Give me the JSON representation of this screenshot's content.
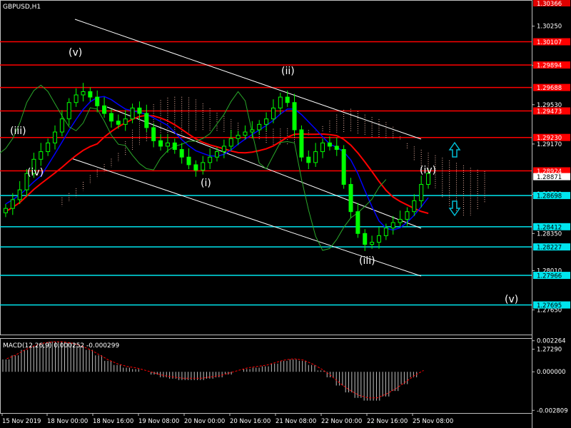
{
  "chart_data": [
    {
      "type": "candlestick",
      "title": "GBPUSD,H1",
      "yaxis_ticks": [
        "1.30250",
        "1.29890",
        "1.29530",
        "1.29170",
        "1.28710",
        "1.28350",
        "1.28010",
        "1.27650",
        "1.27290"
      ],
      "x_ticks": [
        "15 Nov 2019",
        "18 Nov 00:00",
        "18 Nov 16:00",
        "19 Nov 08:00",
        "20 Nov 00:00",
        "20 Nov 16:00",
        "21 Nov 08:00",
        "22 Nov 00:00",
        "22 Nov 16:00",
        "25 Nov 08:00"
      ],
      "ylim": [
        1.2745,
        1.3047
      ],
      "price_tag": {
        "value": "1.30366",
        "color": "#e00000"
      },
      "levels": [
        {
          "value": 1.30107,
          "label": "1.30107",
          "color": "#ff0000"
        },
        {
          "value": 1.29894,
          "label": "1.29894",
          "color": "#ff0000"
        },
        {
          "value": 1.29688,
          "label": "1.29688",
          "color": "#ff0000"
        },
        {
          "value": 1.29473,
          "label": "1.29473",
          "color": "#ff0000"
        },
        {
          "value": 1.2923,
          "label": "1.29230",
          "color": "#ff0000"
        },
        {
          "value": 1.28924,
          "label": "1.28924",
          "color": "#ff0000"
        },
        {
          "value": 1.28698,
          "label": "1.28698",
          "color": "#00e5ee"
        },
        {
          "value": 1.28412,
          "label": "1.28412",
          "color": "#00e5ee"
        },
        {
          "value": 1.28227,
          "label": "1.28227",
          "color": "#00e5ee"
        },
        {
          "value": 1.27966,
          "label": "1.27966",
          "color": "#00e5ee"
        },
        {
          "value": 1.27695,
          "label": "1.27695",
          "color": "#00e5ee"
        }
      ],
      "current_price": {
        "value": 1.28871,
        "label": "1.28871"
      },
      "wave_labels": [
        "(iii)",
        "(iv)",
        "(v)",
        "(i)",
        "(ii)",
        "(iii)",
        "(iv)",
        "(v)"
      ],
      "close_series": [
        1.2858,
        1.2866,
        1.2875,
        1.289,
        1.2903,
        1.291,
        1.2918,
        1.2928,
        1.294,
        1.2955,
        1.2962,
        1.2965,
        1.296,
        1.2952,
        1.2945,
        1.2938,
        1.2935,
        1.294,
        1.295,
        1.2945,
        1.2932,
        1.292,
        1.2915,
        1.2918,
        1.2912,
        1.2905,
        1.2898,
        1.2893,
        1.29,
        1.2905,
        1.291,
        1.2915,
        1.2922,
        1.2925,
        1.2928,
        1.293,
        1.2935,
        1.294,
        1.295,
        1.296,
        1.2955,
        1.293,
        1.2905,
        1.29,
        1.291,
        1.2918,
        1.2915,
        1.2912,
        1.288,
        1.2855,
        1.2835,
        1.2825,
        1.2827,
        1.2833,
        1.284,
        1.2845,
        1.2848,
        1.2855,
        1.2865,
        1.288,
        1.289
      ],
      "colors": {
        "bull": "#00ff00",
        "bear": "#00aa00",
        "ma_red": "#ff0000",
        "ma_blue": "#0000ff",
        "ma_green": "#2aa92a",
        "channel": "#ffffff",
        "arrow": "#00bcd4",
        "cloud": "#f2b8a8",
        "macd_hist": "#c0c0c0",
        "macd_signal": "#ff0000"
      }
    },
    {
      "type": "bar",
      "title": "MACD(12,26,9) 0.000252 -0.000299",
      "yaxis_ticks": [
        "0.002264",
        "0.000000",
        "-0.002809"
      ],
      "ylim": [
        -0.0029,
        0.0023
      ],
      "values": [
        0.0009,
        0.0012,
        0.0016,
        0.0019,
        0.0021,
        0.0022,
        0.0022,
        0.0021,
        0.0019,
        0.0016,
        0.0012,
        0.0008,
        0.0005,
        0.0003,
        0.0002,
        0.0,
        -0.0002,
        -0.0004,
        -0.0005,
        -0.0006,
        -0.0006,
        -0.0006,
        -0.0005,
        -0.0004,
        -0.0002,
        0.0,
        0.0002,
        0.0003,
        0.0004,
        0.0006,
        0.0008,
        0.0009,
        0.0008,
        0.0005,
        0.0001,
        -0.0004,
        -0.001,
        -0.0015,
        -0.0019,
        -0.0021,
        -0.0021,
        -0.0018,
        -0.0014,
        -0.0009,
        -0.0004,
        0.0
      ]
    }
  ]
}
